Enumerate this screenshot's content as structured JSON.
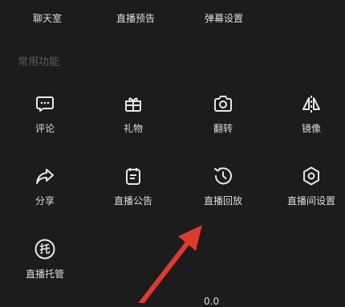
{
  "top_row": [
    {
      "label": "聊天室"
    },
    {
      "label": "直播预告"
    },
    {
      "label": "弹幕设置"
    }
  ],
  "section": {
    "title": "常用功能"
  },
  "functions": [
    {
      "label": "评论",
      "icon": "comment-icon"
    },
    {
      "label": "礼物",
      "icon": "gift-icon"
    },
    {
      "label": "翻转",
      "icon": "camera-flip-icon"
    },
    {
      "label": "镜像",
      "icon": "mirror-icon"
    },
    {
      "label": "分享",
      "icon": "share-icon"
    },
    {
      "label": "直播公告",
      "icon": "announcement-icon"
    },
    {
      "label": "直播回放",
      "icon": "replay-icon"
    },
    {
      "label": "直播间设置",
      "icon": "settings-icon"
    },
    {
      "label": "直播托管",
      "icon": "hosting-icon",
      "glyph": "托"
    }
  ],
  "annotation": {
    "color": "#e03a2f",
    "icon": "red-arrow-annotation"
  },
  "bottom": {
    "text": "0.0"
  },
  "colors": {
    "background": "#1c1c1c",
    "text": "#dcdcdc",
    "section_title": "#5c5c5c"
  }
}
